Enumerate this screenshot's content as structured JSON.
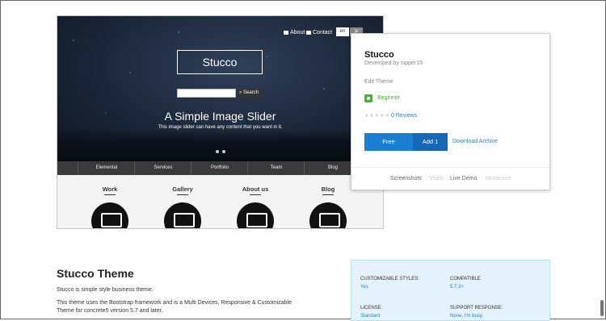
{
  "screenshot": {
    "nav": {
      "about": "About",
      "contact": "Contact",
      "lang_en": "en",
      "lang_ja": "ja"
    },
    "logo": "Stucco",
    "search_button": "Search",
    "hero_title": "A Simple Image Slider",
    "hero_subtitle": "This image slider can have any content that you want in it.",
    "menu": [
      "Elemental",
      "Services",
      "Portfolio",
      "Team",
      "Blog"
    ],
    "features": [
      "Work",
      "Gallery",
      "About us",
      "Blog"
    ]
  },
  "popup": {
    "title": "Stucco",
    "developer": "Developed by nipper15",
    "edit_theme": "Edit Theme",
    "level": "Beginner",
    "rating_stars": "★★★★★",
    "reviews": "0 Reviews",
    "free_label": "Free",
    "add_label": "Add 1",
    "download_label": "Download Archive",
    "tabs": [
      "Screenshots",
      "Video",
      "Live Demo",
      "Showcase"
    ]
  },
  "content": {
    "heading": "Stucco Theme",
    "intro": "Stucco is simple style business theme.",
    "desc": "This theme uses the Bootstrap framework and is a Multi Devices, Responsive & Customizable Theme for concrete5 version 5.7 and later."
  },
  "specs": {
    "customizable_label": "Customizable Styles:",
    "customizable_value": "Yes",
    "compatible_label": "Compatible",
    "compatible_value": "5.7.3+",
    "license_label": "License:",
    "license_value": "Standard",
    "support_label": "Support Response:",
    "support_value": "None, I'm busy."
  },
  "colors": {
    "accent": "#1b7fd1",
    "beginner": "#4fae3d",
    "spec_bg": "#e3f2fb"
  }
}
